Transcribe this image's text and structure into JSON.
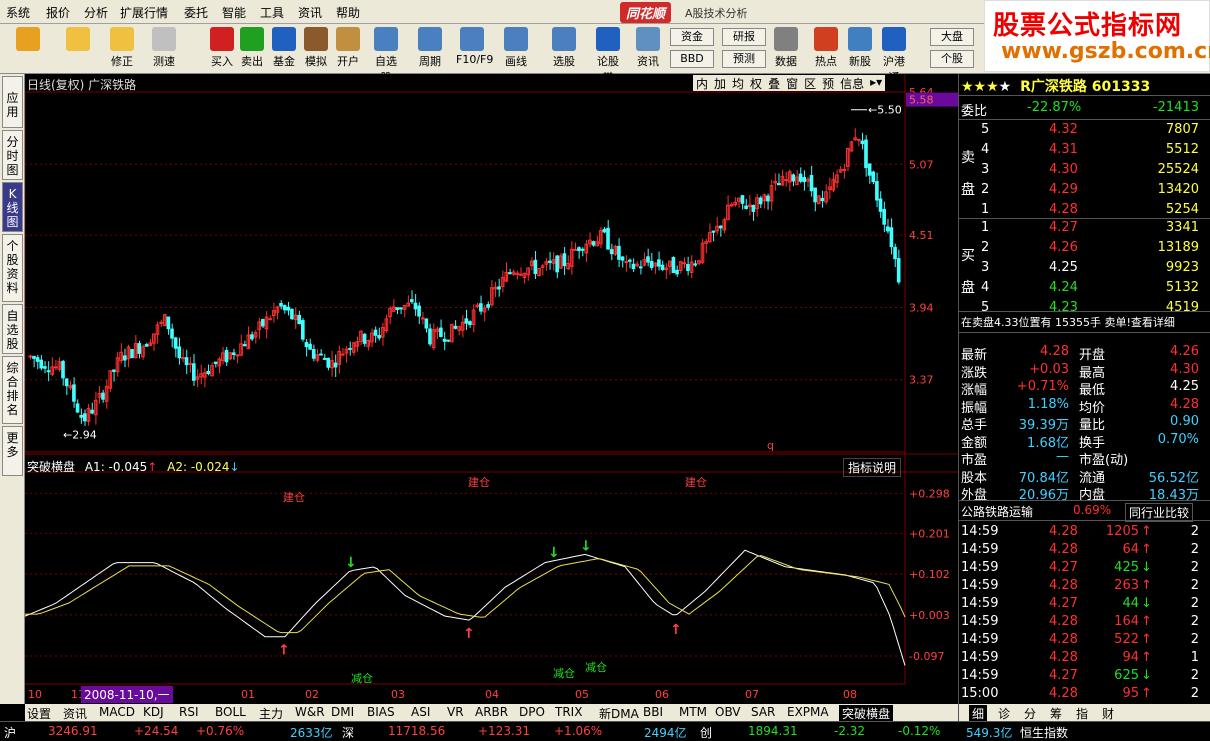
{
  "menu": [
    "系统",
    "报价",
    "分析",
    "扩展行情",
    "委托",
    "智能",
    "工具",
    "资讯",
    "帮助"
  ],
  "app": {
    "logo": "同花顺",
    "subtitle": "A股技术分析"
  },
  "toolbar": [
    {
      "label": "",
      "name": "windows-icon"
    },
    {
      "label": "",
      "name": "back-arrow-icon"
    },
    {
      "label": "修正",
      "name": "adjust-icon"
    },
    {
      "label": "测速",
      "name": "clock-icon"
    },
    {
      "label": "买入",
      "name": "buy-icon"
    },
    {
      "label": "卖出",
      "name": "sell-icon"
    },
    {
      "label": "基金",
      "name": "fund-icon"
    },
    {
      "label": "模拟",
      "name": "hammer-icon"
    },
    {
      "label": "开户",
      "name": "lock-icon"
    },
    {
      "label": "自选股",
      "name": "star-icon"
    },
    {
      "label": "周期",
      "name": "period-icon"
    },
    {
      "label": "F10/F9",
      "name": "f10-icon"
    },
    {
      "label": "画线",
      "name": "pen-icon"
    },
    {
      "label": "选股",
      "name": "select-stock-icon"
    },
    {
      "label": "论股堂",
      "name": "discuss-icon"
    },
    {
      "label": "资讯",
      "name": "news-icon"
    },
    {
      "label": "数据",
      "name": "pe-icon"
    },
    {
      "label": "热点",
      "name": "hot-icon"
    },
    {
      "label": "新股",
      "name": "newstock-icon"
    },
    {
      "label": "沪港通",
      "name": "hk-icon"
    }
  ],
  "toolbar_small": {
    "zijin": "资金",
    "yanbao": "研报",
    "bbd": "BBD",
    "yuce": "预测",
    "dapan": "大盘",
    "gegu": "个股"
  },
  "watermark": {
    "line1": "股票公式指标网",
    "line2": "www.gszb.com.cn"
  },
  "lefttabs": [
    "应用",
    "分时图",
    "K线图",
    "个股资料",
    "自选股",
    "综合排名",
    "更多"
  ],
  "chart": {
    "header": "日线(复权)  广深铁路",
    "buttons": [
      "内",
      "加",
      "均",
      "权",
      "叠",
      "窗",
      "区",
      "预",
      "信息"
    ],
    "y_labels": [
      "5.64",
      "5.07",
      "4.51",
      "3.94",
      "3.37"
    ],
    "cur_price_tag": "5.58",
    "high_label": "5.50",
    "low_label": "2.94",
    "q_label": "q",
    "x_labels": [
      "10",
      "11",
      "01",
      "02",
      "03",
      "04",
      "05",
      "06",
      "07",
      "08"
    ],
    "date_tag": "2008-11-10,一"
  },
  "indicator": {
    "name": "突破横盘",
    "a1": "A1: -0.045",
    "a2": "A2: -0.024",
    "help": "指标说明",
    "y_labels": [
      "+0.298",
      "+0.201",
      "+0.102",
      "+0.003",
      "-0.097"
    ],
    "build_label": "建仓",
    "reduce_label": "减仓"
  },
  "bottomtabs": [
    "设置",
    "资讯",
    "MACD",
    "KDJ",
    "RSI",
    "BOLL",
    "主力",
    "W&R",
    "DMI",
    "BIAS",
    "ASI",
    "VR",
    "ARBR",
    "DPO",
    "TRIX",
    "新DMA",
    "BBI",
    "MTM",
    "OBV",
    "SAR",
    "EXPMA",
    "突破横盘"
  ],
  "quote": {
    "title": "R广深铁路 601333",
    "weibi": {
      "label": "委比",
      "pct": "-22.87%",
      "diff": "-21413"
    },
    "sell_label": "卖盘",
    "buy_label": "买盘",
    "sell": [
      [
        "5",
        "4.32",
        "7807"
      ],
      [
        "4",
        "4.31",
        "5512"
      ],
      [
        "3",
        "4.30",
        "25524"
      ],
      [
        "2",
        "4.29",
        "13420"
      ],
      [
        "1",
        "4.28",
        "5254"
      ]
    ],
    "buy": [
      [
        "1",
        "4.27",
        "3341"
      ],
      [
        "2",
        "4.26",
        "13189"
      ],
      [
        "3",
        "4.25",
        "9923"
      ],
      [
        "4",
        "4.24",
        "5132"
      ],
      [
        "5",
        "4.23",
        "4519"
      ]
    ],
    "notice": "在卖盘4.33位置有  15355手 卖单!查看详细",
    "stats": [
      [
        "最新",
        "4.28",
        "开盘",
        "4.26"
      ],
      [
        "涨跌",
        "+0.03",
        "最高",
        "4.30"
      ],
      [
        "涨幅",
        "+0.71%",
        "最低",
        "4.25"
      ],
      [
        "振幅",
        "1.18%",
        "均价",
        "4.28"
      ],
      [
        "总手",
        "39.39万",
        "量比",
        "0.90"
      ],
      [
        "金额",
        "1.68亿",
        "换手",
        "0.70%"
      ],
      [
        "市盈",
        "—",
        "市盈(动)",
        ""
      ],
      [
        "股本",
        "70.84亿",
        "流通",
        "56.52亿"
      ],
      [
        "外盘",
        "20.96万",
        "内盘",
        "18.43万"
      ]
    ],
    "industry": {
      "name": "公路铁路运输",
      "pct": "0.69%",
      "compare": "同行业比较"
    },
    "ticks": [
      [
        "14:59",
        "4.28",
        "1205",
        "up",
        "2"
      ],
      [
        "14:59",
        "4.28",
        "64",
        "up",
        "2"
      ],
      [
        "14:59",
        "4.27",
        "425",
        "down",
        "2"
      ],
      [
        "14:59",
        "4.28",
        "263",
        "up",
        "2"
      ],
      [
        "14:59",
        "4.27",
        "44",
        "down",
        "2"
      ],
      [
        "14:59",
        "4.28",
        "164",
        "up",
        "2"
      ],
      [
        "14:59",
        "4.28",
        "522",
        "up",
        "2"
      ],
      [
        "14:59",
        "4.28",
        "94",
        "up",
        "1"
      ],
      [
        "14:59",
        "4.27",
        "625",
        "down",
        "2"
      ],
      [
        "15:00",
        "4.28",
        "95",
        "up",
        "2"
      ]
    ],
    "ticktabs": [
      "细",
      "诊",
      "分",
      "筹",
      "指",
      "财"
    ]
  },
  "status": [
    {
      "t": "沪",
      "c": "#fff"
    },
    {
      "t": "3246.91",
      "c": "#ff4040"
    },
    {
      "t": "+24.54",
      "c": "#ff4040"
    },
    {
      "t": "+0.76%",
      "c": "#ff4040"
    },
    {
      "t": "2633亿",
      "c": "#40d0ff"
    },
    {
      "t": "深",
      "c": "#fff"
    },
    {
      "t": "11718.56",
      "c": "#ff4040"
    },
    {
      "t": "+123.31",
      "c": "#ff4040"
    },
    {
      "t": "+1.06%",
      "c": "#ff4040"
    },
    {
      "t": "2494亿",
      "c": "#40d0ff"
    },
    {
      "t": "创",
      "c": "#fff"
    },
    {
      "t": "1894.31",
      "c": "#20e020"
    },
    {
      "t": "-2.32",
      "c": "#20e020"
    },
    {
      "t": "-0.12%",
      "c": "#20e020"
    },
    {
      "t": "549.3亿",
      "c": "#40d0ff"
    },
    {
      "t": "恒生指数",
      "c": "#fff"
    }
  ],
  "colors": {
    "up": "#ff3030",
    "down": "#40ffff",
    "bg": "#000000",
    "grid": "#7a0000",
    "purple": "#6a0a9a"
  }
}
